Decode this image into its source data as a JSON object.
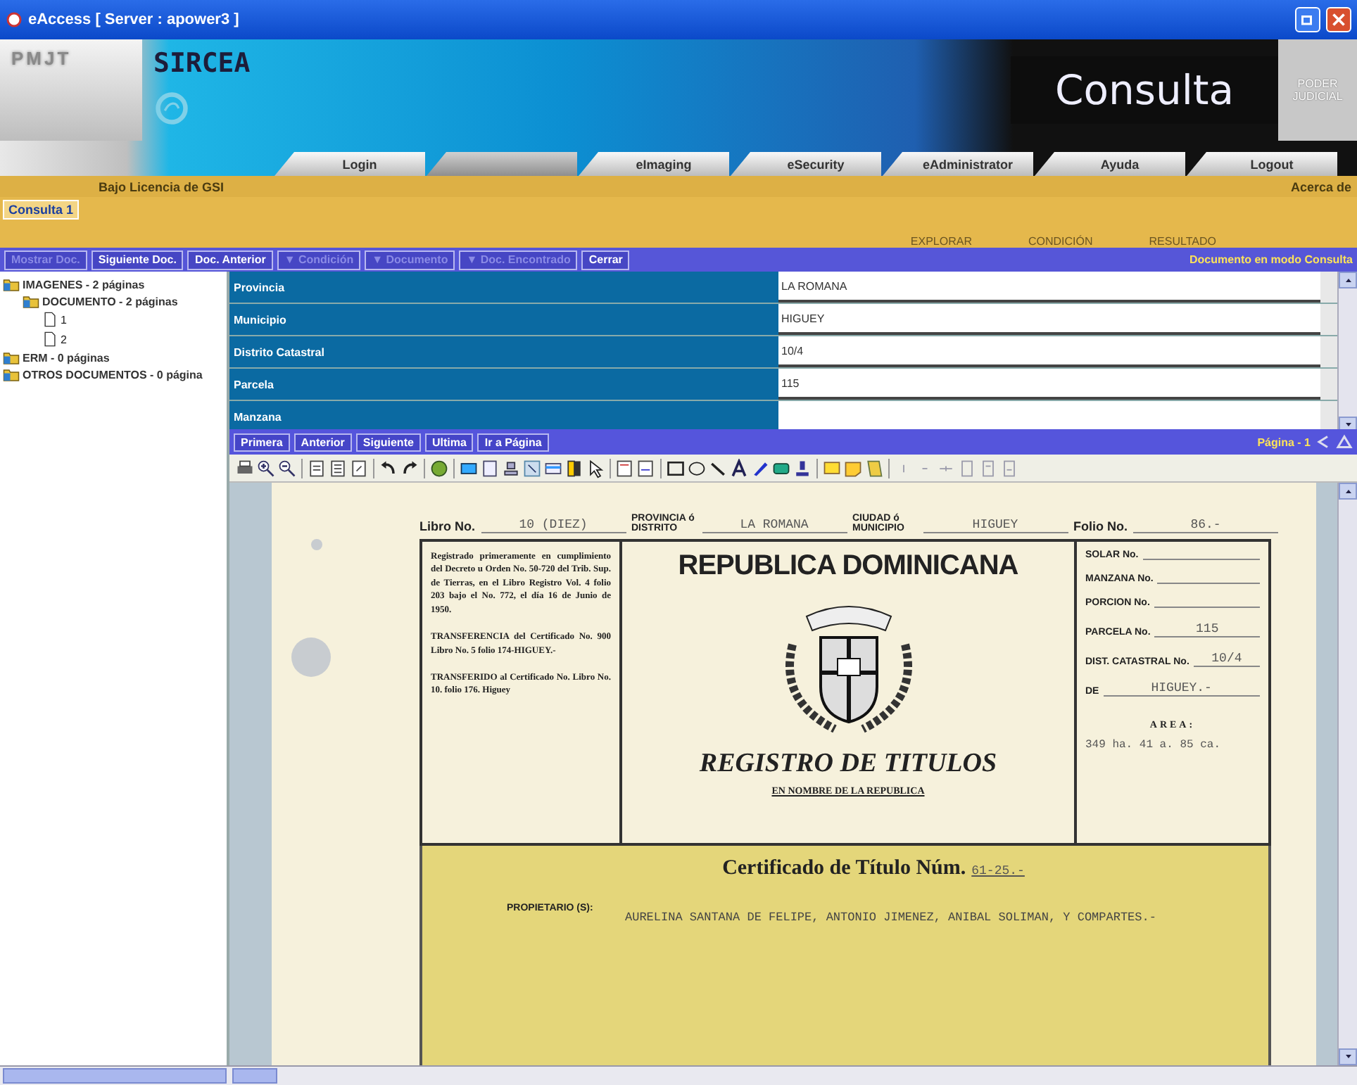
{
  "window": {
    "title": "eAccess [ Server : apower3 ]"
  },
  "header": {
    "logo_left": "PMJT",
    "brand": "SIRCEA",
    "module": "Consulta",
    "logo_right": [
      "PODER",
      "JUDICIAL"
    ]
  },
  "nav_tabs": [
    {
      "label": "Login"
    },
    {
      "kind": "blank"
    },
    {
      "label": "eImaging"
    },
    {
      "label": "eSecurity"
    },
    {
      "label": "eAdministrator"
    },
    {
      "label": "Ayuda"
    },
    {
      "label": "Logout"
    }
  ],
  "license": "Bajo Licencia de GSI",
  "about_link": "Acerca de",
  "query_tabs": [
    {
      "label": "Consulta 1",
      "selected": true
    }
  ],
  "steps": [
    "EXPLORAR",
    "CONDICIÓN",
    "RESULTADO"
  ],
  "actions": [
    {
      "label": "Mostrar Doc.",
      "disabled": true
    },
    {
      "label": "Siguiente Doc.",
      "disabled": false
    },
    {
      "label": "Doc. Anterior",
      "disabled": false
    },
    {
      "label": "▼ Condición",
      "disabled": true
    },
    {
      "label": "▼ Documento",
      "disabled": true
    },
    {
      "label": "▼ Doc. Encontrado",
      "disabled": true
    },
    {
      "label": "Cerrar",
      "disabled": false
    }
  ],
  "mode_status": "Documento en modo Consulta",
  "tree": [
    {
      "label": "IMAGENES - 2 páginas",
      "kind": "folder",
      "children": [
        {
          "label": "DOCUMENTO - 2 páginas",
          "kind": "folder",
          "children": [
            {
              "label": "1",
              "kind": "page"
            },
            {
              "label": "2",
              "kind": "page"
            }
          ]
        }
      ]
    },
    {
      "label": "ERM - 0 páginas",
      "kind": "folder"
    },
    {
      "label": "OTROS DOCUMENTOS - 0 página",
      "kind": "folder"
    }
  ],
  "fields": [
    {
      "label": "Provincia",
      "value": "LA ROMANA"
    },
    {
      "label": "Municipio",
      "value": "HIGUEY"
    },
    {
      "label": "Distrito Catastral",
      "value": "10/4"
    },
    {
      "label": "Parcela",
      "value": "115"
    },
    {
      "label": "Manzana"
    }
  ],
  "pager": {
    "buttons": [
      "Primera",
      "Anterior",
      "Siguiente",
      "Ultima",
      "Ir a Página"
    ],
    "page_label": "Página - 1"
  },
  "document": {
    "header_fields": [
      {
        "label": "Libro No.",
        "value": "10 (DIEZ)"
      },
      {
        "label": "PROVINCIA ó DISTRITO",
        "value": "LA ROMANA"
      },
      {
        "label": "CIUDAD ó MUNICIPIO",
        "value": "HIGUEY"
      },
      {
        "label": "Folio No.",
        "value": "86.-"
      }
    ],
    "registration_notes": [
      "Registrado primeramente en cumplimiento del Decreto u Orden No. 50-720 del Trib. Sup. de Tierras, en el Libro Registro Vol. 4 folio 203 bajo el No. 772, el día 16 de Junio de 1950.",
      "TRANSFERENCIA del Certificado No. 900 Libro No. 5 folio 174-HIGUEY.-",
      "TRANSFERIDO al Certificado No. Libro No. 10. folio 176. Higuey"
    ],
    "title": "REPUBLICA DOMINICANA",
    "registry": "REGISTRO DE TITULOS",
    "subtitle": "EN NOMBRE DE LA REPUBLICA",
    "parcel_fields": [
      {
        "label": "SOLAR No."
      },
      {
        "label": "MANZANA No."
      },
      {
        "label": "PORCION No."
      },
      {
        "label": "PARCELA No.",
        "value": "115"
      },
      {
        "label": "DIST. CATASTRAL No.",
        "value": "10/4"
      },
      {
        "label": "DE",
        "value": "HIGUEY.-"
      }
    ],
    "area_label": "AREA:",
    "area_value": "349 ha. 41 a. 85 ca.",
    "certificate_title": "Certificado de Título Núm.",
    "certificate_number": "61-25.-",
    "owner_label": "PROPIETARIO (S):",
    "owner": "AURELINA SANTANA DE FELIPE, ANTONIO JIMENEZ, ANIBAL SOLIMAN, Y COMPARTES.-"
  }
}
